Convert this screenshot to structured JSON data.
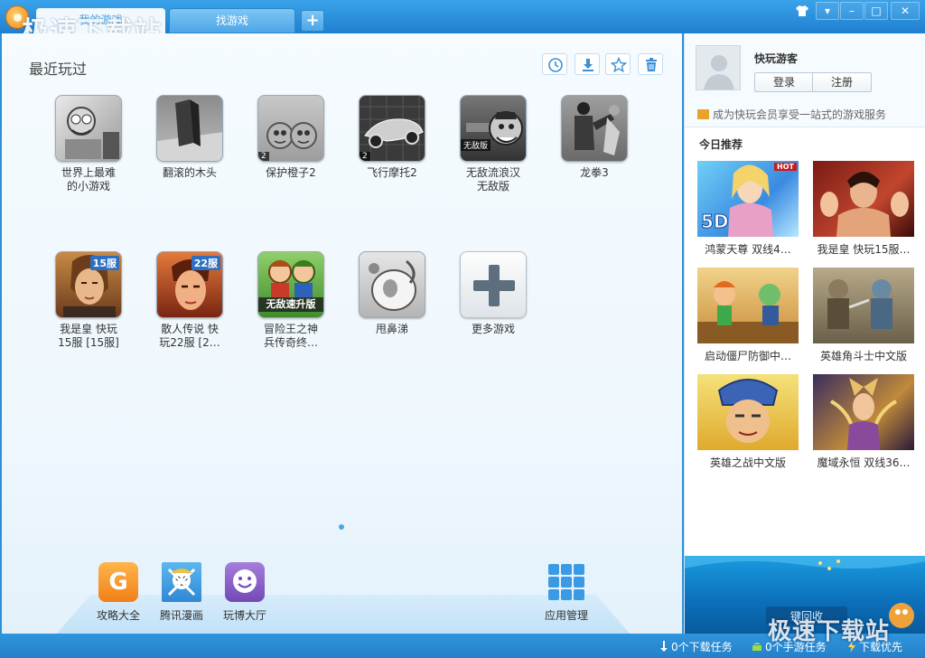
{
  "watermark": "极速下载站",
  "tabs": {
    "active_label": "我的游戏",
    "find_label": "找游戏",
    "add_label": "+"
  },
  "window_controls": {
    "skin": "skin-icon",
    "menu": "▾",
    "minimize": "–",
    "maximize": "□",
    "close": "✕"
  },
  "recent": {
    "title": "最近玩过",
    "tools": [
      "clock-icon",
      "download-icon",
      "star-icon",
      "trash-icon"
    ],
    "games": [
      {
        "name_l1": "世界上最难",
        "name_l2": "的小游戏"
      },
      {
        "name_l1": "翻滚的木头",
        "name_l2": ""
      },
      {
        "name_l1": "保护橙子2",
        "name_l2": "",
        "corner": "2"
      },
      {
        "name_l1": "飞行摩托2",
        "name_l2": "",
        "corner": "2"
      },
      {
        "name_l1": "无敌流浪汉",
        "name_l2": "无敌版",
        "corner": "无敌版"
      },
      {
        "name_l1": "龙拳3",
        "name_l2": ""
      },
      {
        "name_l1": "我是皇 快玩",
        "name_l2": "15服 [15服]",
        "badge": "15服"
      },
      {
        "name_l1": "散人传说 快",
        "name_l2": "玩22服 [2…",
        "badge": "22服"
      },
      {
        "name_l1": "冒险王之神",
        "name_l2": "兵传奇终…",
        "ribbon": "无敌速升版"
      },
      {
        "name_l1": "甩鼻涕",
        "name_l2": ""
      },
      {
        "name_l1": "更多游戏",
        "name_l2": ""
      }
    ]
  },
  "bottom_apps": [
    {
      "label": "攻略大全",
      "icon": "G"
    },
    {
      "label": "腾讯漫画",
      "icon": "manga-icon"
    },
    {
      "label": "玩博大厅",
      "icon": "smile-icon"
    },
    {
      "label": "应用管理",
      "icon": "app-grid-icon"
    }
  ],
  "user": {
    "name": "快玩游客",
    "login": "登录",
    "register": "注册",
    "vip_text": "成为快玩会员享受一站式的游戏服务"
  },
  "recommend": {
    "title": "今日推荐",
    "hot": "HOT",
    "items": [
      {
        "name": "鸿蒙天尊 双线4…",
        "caption": "5D"
      },
      {
        "name": "我是皇 快玩15服…"
      },
      {
        "name": "启动僵尸防御中…"
      },
      {
        "name": "英雄角斗士中文版"
      },
      {
        "name": "英雄之战中文版"
      },
      {
        "name": "魔域永恒 双线36…"
      }
    ]
  },
  "banner": {
    "caption": "键回收"
  },
  "status": {
    "download_tasks": "0个下载任务",
    "mobile_tasks": "0个手游任务",
    "download_priority": "下载优先"
  }
}
